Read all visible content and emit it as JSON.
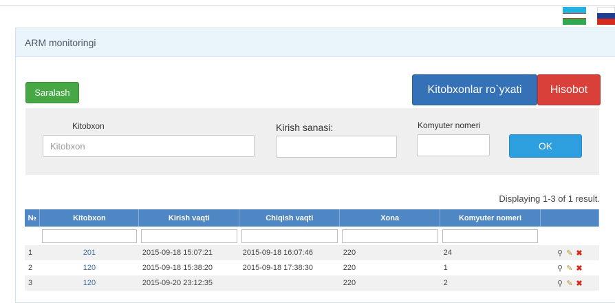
{
  "panel": {
    "title": "ARM monitoringi"
  },
  "buttons": {
    "sort": "Saralash",
    "readers_list": "Kitobxonlar ro`yxati",
    "report": "Hisobot",
    "ok": "OK"
  },
  "filter": {
    "reader_label": "Kitobxon",
    "reader_placeholder": "Kitobxon",
    "entry_date_label": "Kirish sanasi:",
    "computer_label": "Komyuter nomeri"
  },
  "summary": "Displaying 1-3 of 1 result.",
  "table": {
    "headers": [
      "№",
      "Kitobxon",
      "Kirish vaqti",
      "Chiqish vaqti",
      "Xona",
      "Komyuter nomeri"
    ],
    "rows": [
      {
        "n": "1",
        "reader": "201",
        "entry": "2015-09-18 15:07:21",
        "exit": "2015-09-18 16:07:46",
        "room": "220",
        "computer": "24"
      },
      {
        "n": "2",
        "reader": "120",
        "entry": "2015-09-18 15:38:20",
        "exit": "2015-09-18 17:38:30",
        "room": "220",
        "computer": "1"
      },
      {
        "n": "3",
        "reader": "120",
        "entry": "2015-09-20 23:12:35",
        "exit": "",
        "room": "220",
        "computer": "2"
      }
    ]
  },
  "icons": {
    "view": "magnifier-icon",
    "edit": "pencil-icon",
    "delete": "cross-icon"
  },
  "colors": {
    "green": "#45a845",
    "blue": "#3471b7",
    "red": "#d9403a",
    "header": "#4f87c4",
    "ok": "#2e9fde"
  }
}
